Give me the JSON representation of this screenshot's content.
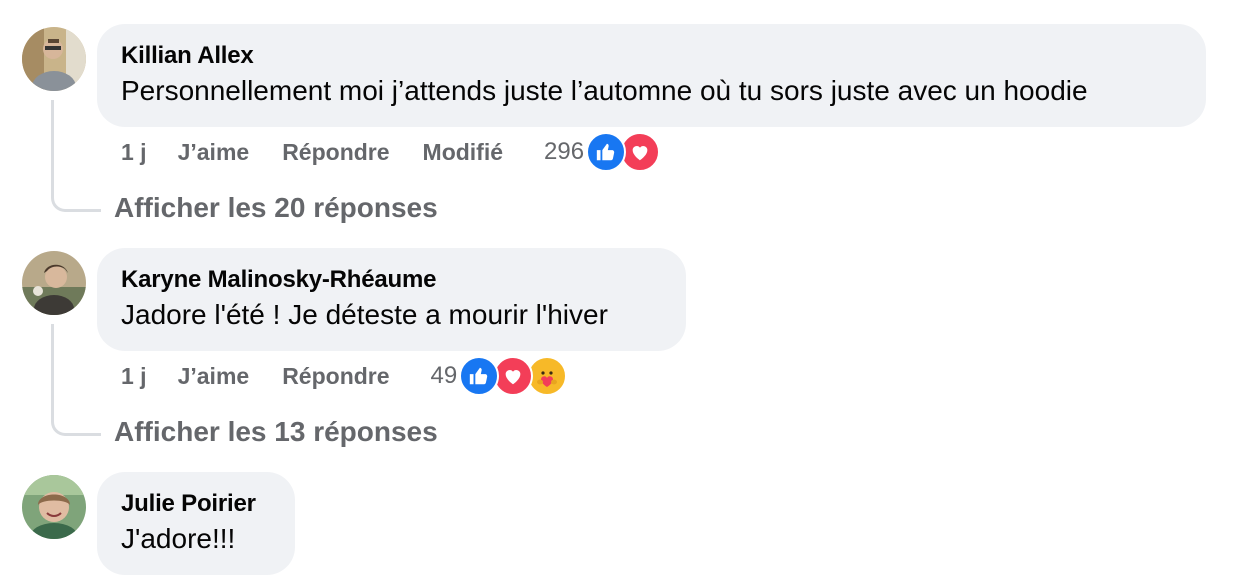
{
  "comments": [
    {
      "author": "Killian Allex",
      "text": "Personnellement moi j’attends juste l’automne où tu sors juste avec un hoodie",
      "time": "1 j",
      "like_label": "J’aime",
      "reply_label": "Répondre",
      "edited_label": "Modifié",
      "reaction_count": "296",
      "reactions": [
        "like-icon",
        "love-icon"
      ],
      "view_replies": "Afficher les 20 réponses"
    },
    {
      "author": "Karyne Malinosky-Rhéaume",
      "text": "Jadore l'été ! Je déteste a mourir l'hiver",
      "time": "1 j",
      "like_label": "J’aime",
      "reply_label": "Répondre",
      "reaction_count": "49",
      "reactions": [
        "like-icon",
        "love-icon",
        "care-icon"
      ],
      "view_replies": "Afficher les 13 réponses"
    },
    {
      "author": "Julie Poirier",
      "text": "J'adore!!!"
    }
  ],
  "colors": {
    "bubble": "#f0f2f5",
    "secondary_text": "#65676b",
    "like": "#1877f2",
    "love": "#f33e58",
    "care": "#f7b928"
  }
}
